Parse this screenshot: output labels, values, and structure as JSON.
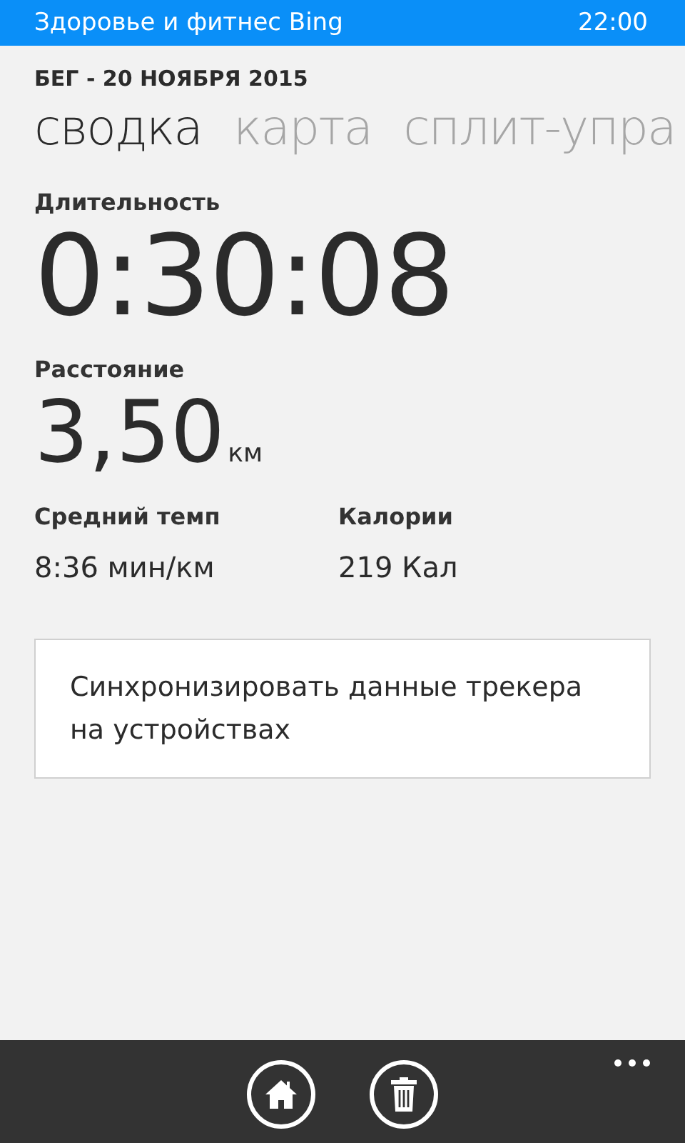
{
  "status_bar": {
    "app_title": "Здоровье и фитнес Bing",
    "time": "22:00"
  },
  "header": "БЕГ - 20 НОЯБРЯ 2015",
  "pivots": [
    {
      "label": "сводка",
      "selected": true
    },
    {
      "label": "карта",
      "selected": false
    },
    {
      "label": "сплит-упра",
      "selected": false
    }
  ],
  "duration": {
    "label": "Длительность",
    "value": "0:30:08"
  },
  "distance": {
    "label": "Расстояние",
    "value": "3,50",
    "unit": "км"
  },
  "stats": [
    {
      "label": "Средний темп",
      "value": "8:36 мин/км"
    },
    {
      "label": "Калории",
      "value": "219 Кал"
    }
  ],
  "sync_button": "Синхронизировать данные трекера на устройствах",
  "app_bar": {
    "buttons": [
      {
        "kind": "home"
      },
      {
        "kind": "delete"
      }
    ]
  }
}
